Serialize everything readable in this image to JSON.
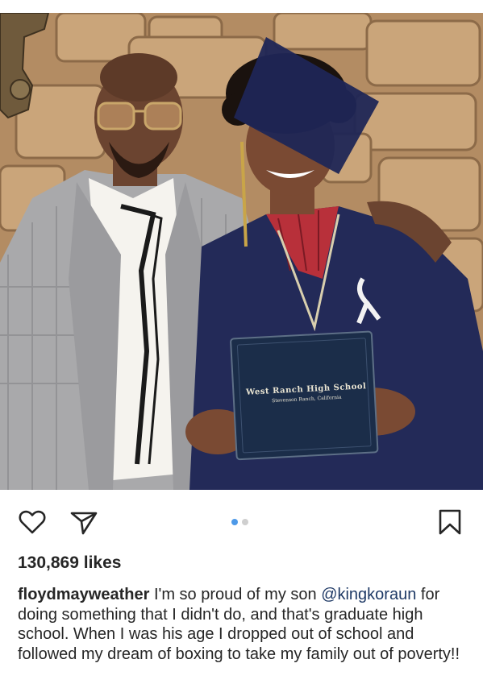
{
  "post": {
    "carousel": {
      "count": 2,
      "active_index": 0
    },
    "diploma": {
      "school": "West Ranch High School",
      "location": "Stevenson Ranch, California"
    },
    "likes_text": "130,869 likes",
    "caption": {
      "username": "floydmayweather",
      "text_before": " I'm so proud of my son ",
      "mention": "@kingkoraun",
      "text_after": " for doing something that I didn't do, and that's graduate high school. When I was his age I dropped out of school and followed my dream of boxing to take my family out of poverty!!"
    }
  },
  "icons": {
    "like": "heart-icon",
    "share": "paper-plane-icon",
    "save": "bookmark-icon"
  },
  "colors": {
    "text": "#262626",
    "mention": "#1f3a66",
    "active_dot": "#4d99e8",
    "inactive_dot": "#cfcfcf"
  }
}
